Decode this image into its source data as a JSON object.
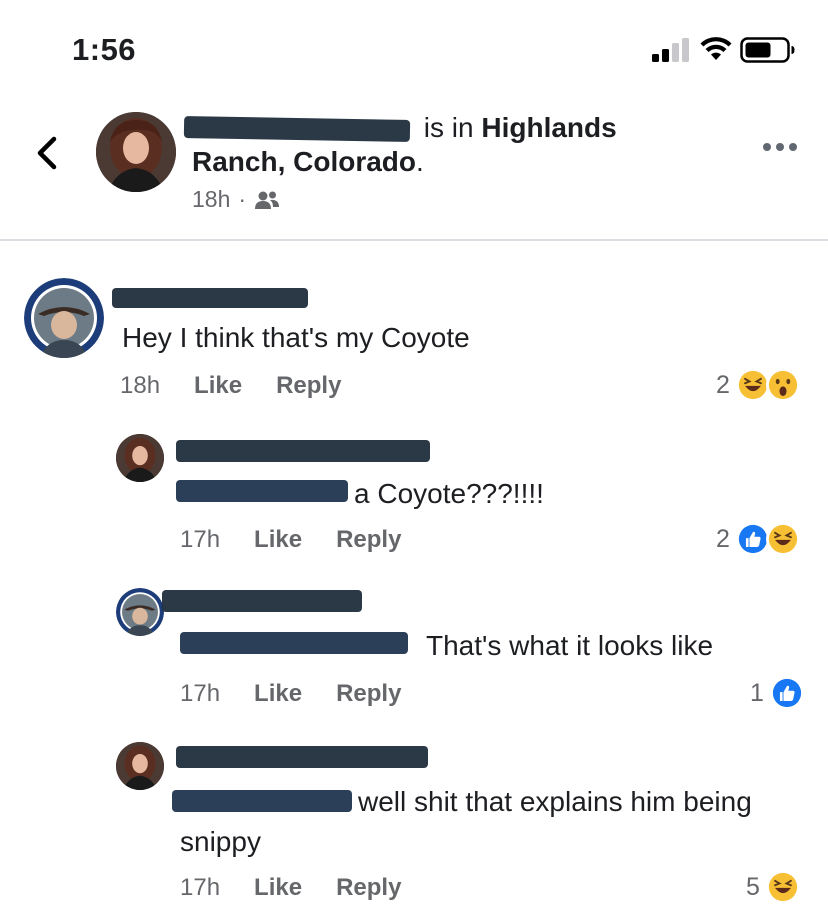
{
  "status_bar": {
    "time": "1:56"
  },
  "post": {
    "is_in_text": "is in",
    "location_line1": "Highlands",
    "location_line2": "Ranch, Colorado",
    "period": ".",
    "timestamp": "18h",
    "separator": "·"
  },
  "comments": [
    {
      "text": "Hey I think that's my Coyote",
      "time": "18h",
      "like_label": "Like",
      "reply_label": "Reply",
      "reaction_count": "2",
      "reactions": [
        "haha-icon",
        "wow-icon"
      ]
    },
    {
      "text": "a Coyote???!!!!",
      "time": "17h",
      "like_label": "Like",
      "reply_label": "Reply",
      "reaction_count": "2",
      "reactions": [
        "like-icon",
        "haha-icon"
      ]
    },
    {
      "text": "That's what it looks like",
      "time": "17h",
      "like_label": "Like",
      "reply_label": "Reply",
      "reaction_count": "1",
      "reactions": [
        "like-icon"
      ]
    },
    {
      "text_line1": "well shit that explains him being",
      "text_line2": "snippy",
      "time": "17h",
      "like_label": "Like",
      "reply_label": "Reply",
      "reaction_count": "5",
      "reactions": [
        "haha-icon"
      ]
    }
  ],
  "colors": {
    "like_blue": "#1877f2",
    "emoji_yellow": "#f7c034",
    "meta_gray": "#65676b"
  }
}
